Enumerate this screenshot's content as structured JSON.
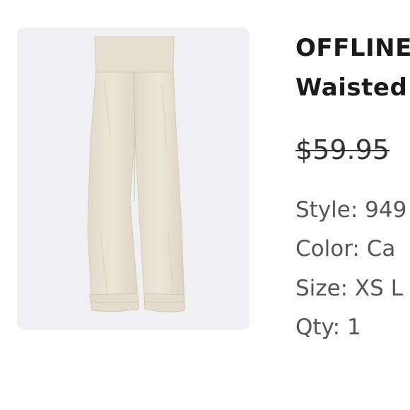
{
  "product": {
    "image_alt": "Cream wide-leg pants",
    "title_line1": "OFFLINE",
    "title_line2": "Waisted",
    "price": "$59.95",
    "style": "Style: 949",
    "color": "Color: Ca",
    "size": "Size: XS L",
    "qty": "Qty: 1"
  },
  "colors": {
    "card_background": "#f0f0f2",
    "pants_fabric": "#e9e2d4",
    "pants_shadow": "#d6cdbb"
  }
}
